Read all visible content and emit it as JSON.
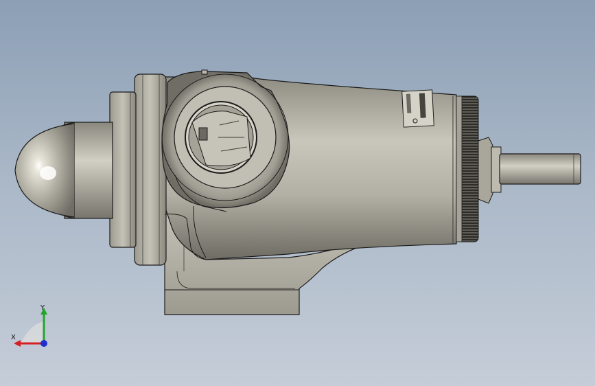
{
  "viewport": {
    "background_top": "#8c9fb5",
    "background_bottom": "#c5cdd8",
    "part_color": "#b8b6a9",
    "edge_color": "#1a1a1a"
  },
  "triad": {
    "x_label": "X",
    "y_label": "Y",
    "x_color": "#d42020",
    "y_color": "#22a62a",
    "z_color": "#1f2fd0"
  }
}
